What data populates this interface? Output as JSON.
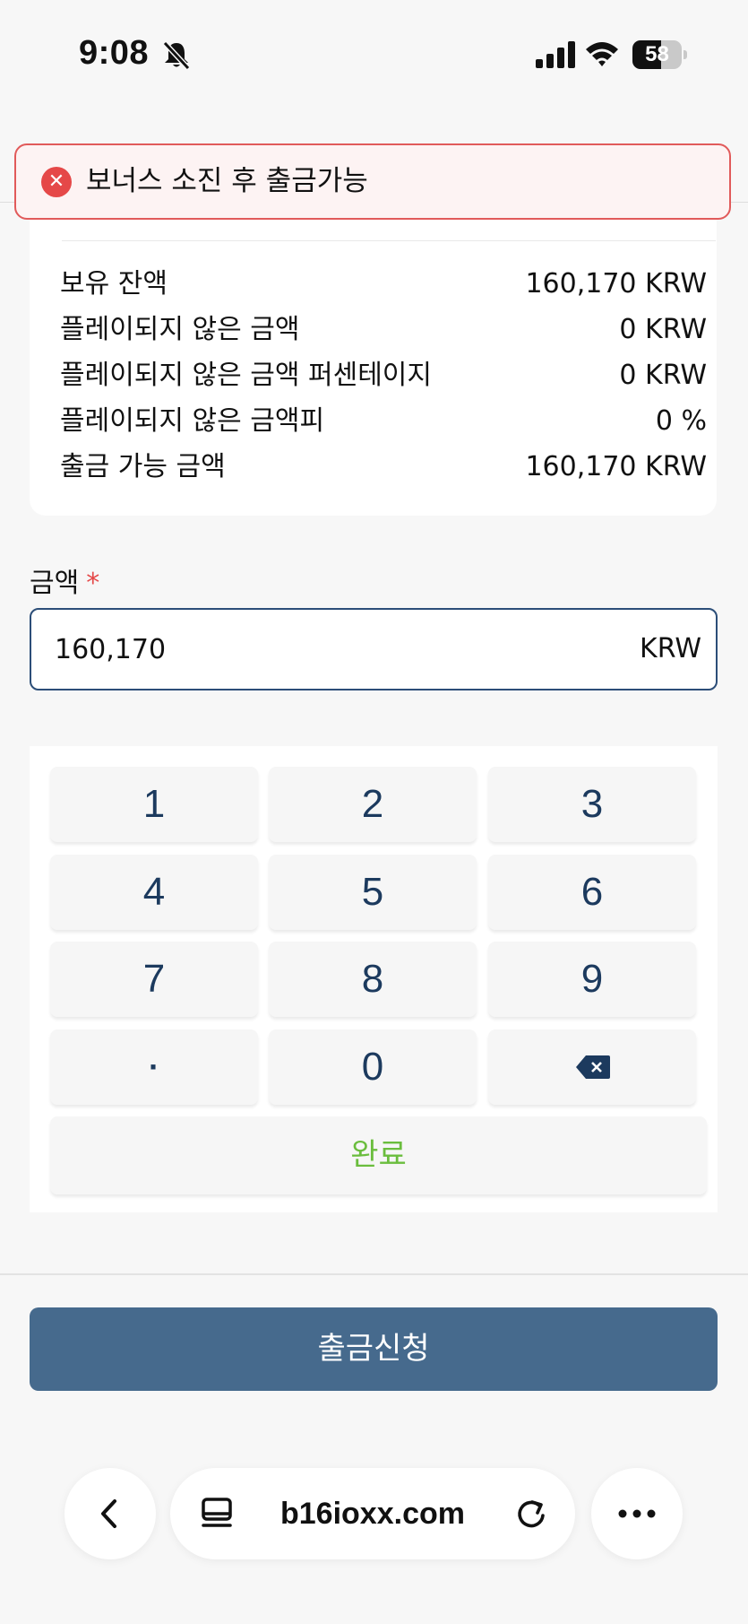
{
  "status_bar": {
    "time": "9:08",
    "battery_percent": "58",
    "battery_level": 0.58,
    "icons": [
      "bell-slash-icon",
      "signal-icon",
      "wifi-icon",
      "battery-icon"
    ]
  },
  "toast": {
    "icon": "error-x-icon",
    "message": "보너스 소진 후 출금가능",
    "color": "#e54848"
  },
  "balance_info": {
    "rows": [
      {
        "label": "보유 잔액",
        "value": "160,170 KRW"
      },
      {
        "label": "플레이되지 않은 금액",
        "value": "0 KRW"
      },
      {
        "label": "플레이되지 않은 금액 퍼센테이지",
        "value": "0 KRW"
      },
      {
        "label": "플레이되지 않은 금액피",
        "value": "0 %"
      },
      {
        "label": "출금 가능 금액",
        "value": "160,170 KRW"
      }
    ]
  },
  "amount_field": {
    "label": "금액",
    "required_mark": "*",
    "value": "160,170",
    "unit": "KRW"
  },
  "keypad": {
    "keys": [
      "1",
      "2",
      "3",
      "4",
      "5",
      "6",
      "7",
      "8",
      "9",
      "·",
      "0"
    ],
    "backspace_icon": "backspace-icon",
    "done_label": "완료",
    "done_color": "#6abd3d",
    "key_text_color": "#1c3a5e"
  },
  "submit": {
    "label": "출금신청",
    "color": "#466a8d"
  },
  "browser_bar": {
    "url": "b16ioxx.com",
    "icons": [
      "back-chevron-icon",
      "tabs-icon",
      "reload-icon",
      "more-icon"
    ]
  }
}
